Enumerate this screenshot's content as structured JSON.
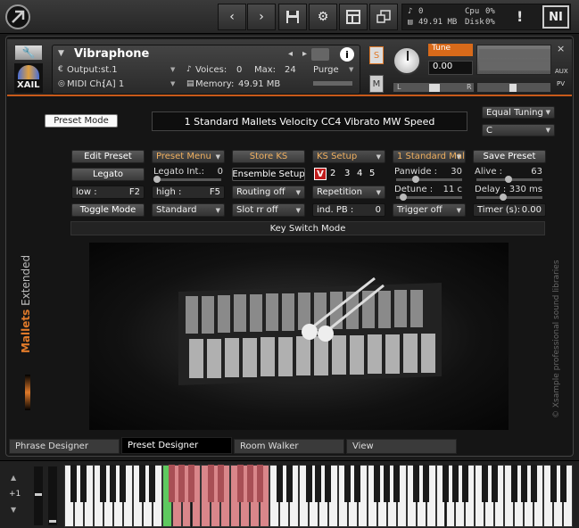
{
  "toolbar": {
    "voices_value": "0",
    "memory_value": "49.91 MB",
    "cpu_label": "Cpu",
    "cpu_value": "0%",
    "disk_label": "Disk",
    "disk_value": "0%",
    "warning_label": "!",
    "ni_label": "NI"
  },
  "header": {
    "brand": "XAIL",
    "instrument_name": "Vibraphone",
    "output_label": "Output:",
    "output_value": "st.1",
    "midi_label": "MIDI Ch:",
    "midi_value": "[A]  1",
    "voices_label": "Voices:",
    "voices_value": "0",
    "max_label": "Max:",
    "max_value": "24",
    "memory_label": "Memory:",
    "memory_value": "49.91 MB",
    "purge_label": "Purge",
    "s_label": "S",
    "m_label": "M",
    "tune_label": "Tune",
    "tune_value": "0.00",
    "pan_left": "L",
    "pan_right": "R",
    "aux_label": "AUX",
    "pv_label": "PV",
    "close_label": "×"
  },
  "main": {
    "preset_mode_label": "Preset Mode",
    "preset_name": "1 Standard Mallets Velocity CC4 Vibrato MW Speed",
    "tuning_value": "Equal Tuning",
    "key_value": "C",
    "row1": {
      "edit_preset": "Edit Preset",
      "preset_menu": "Preset Menu",
      "store_ks": "Store KS",
      "ks_setup": "KS Setup",
      "preset_select": "1 Standard Mallets",
      "save_preset": "Save Preset"
    },
    "row2": {
      "legato": "Legato",
      "legato_int_label": "Legato Int.:",
      "legato_int_value": "0",
      "ensemble_setup": "Ensemble Setup",
      "ks_v": "V",
      "ks_2": "2",
      "ks_3": "3",
      "ks_4": "4",
      "ks_5": "5",
      "panwide_label": "Panwide :",
      "panwide_value": "30",
      "alive_label": "Alive :",
      "alive_value": "63"
    },
    "row3": {
      "low_label": "low :",
      "low_value": "F2",
      "high_label": "high :",
      "high_value": "F5",
      "routing": "Routing off",
      "repetition": "Repetition",
      "detune_label": "Detune :",
      "detune_value": "11 c",
      "delay_label": "Delay :",
      "delay_value": "330 ms"
    },
    "row4": {
      "toggle_mode": "Toggle Mode",
      "standard": "Standard",
      "slot_rr": "Slot rr off",
      "ind_pb_label": "ind. PB :",
      "ind_pb_value": "0",
      "trigger": "Trigger off",
      "timer_label": "Timer (s):",
      "timer_value": "0.00"
    },
    "keyswitch_mode": "Key Switch Mode",
    "side_logo_bold": "Mallets",
    "side_logo_light": " Extended",
    "copyright": "© Xsample professional sound libraries"
  },
  "tabs": [
    {
      "label": "Phrase Designer"
    },
    {
      "label": "Preset Designer"
    },
    {
      "label": "Room Walker"
    },
    {
      "label": "View"
    }
  ],
  "keyboard": {
    "octave_label": "+1",
    "accent_green": "#5fc95f",
    "accent_red": "#d9868a"
  },
  "colors": {
    "accent_orange": "#e07a2a",
    "tuning_orange": "#d86a1a"
  }
}
